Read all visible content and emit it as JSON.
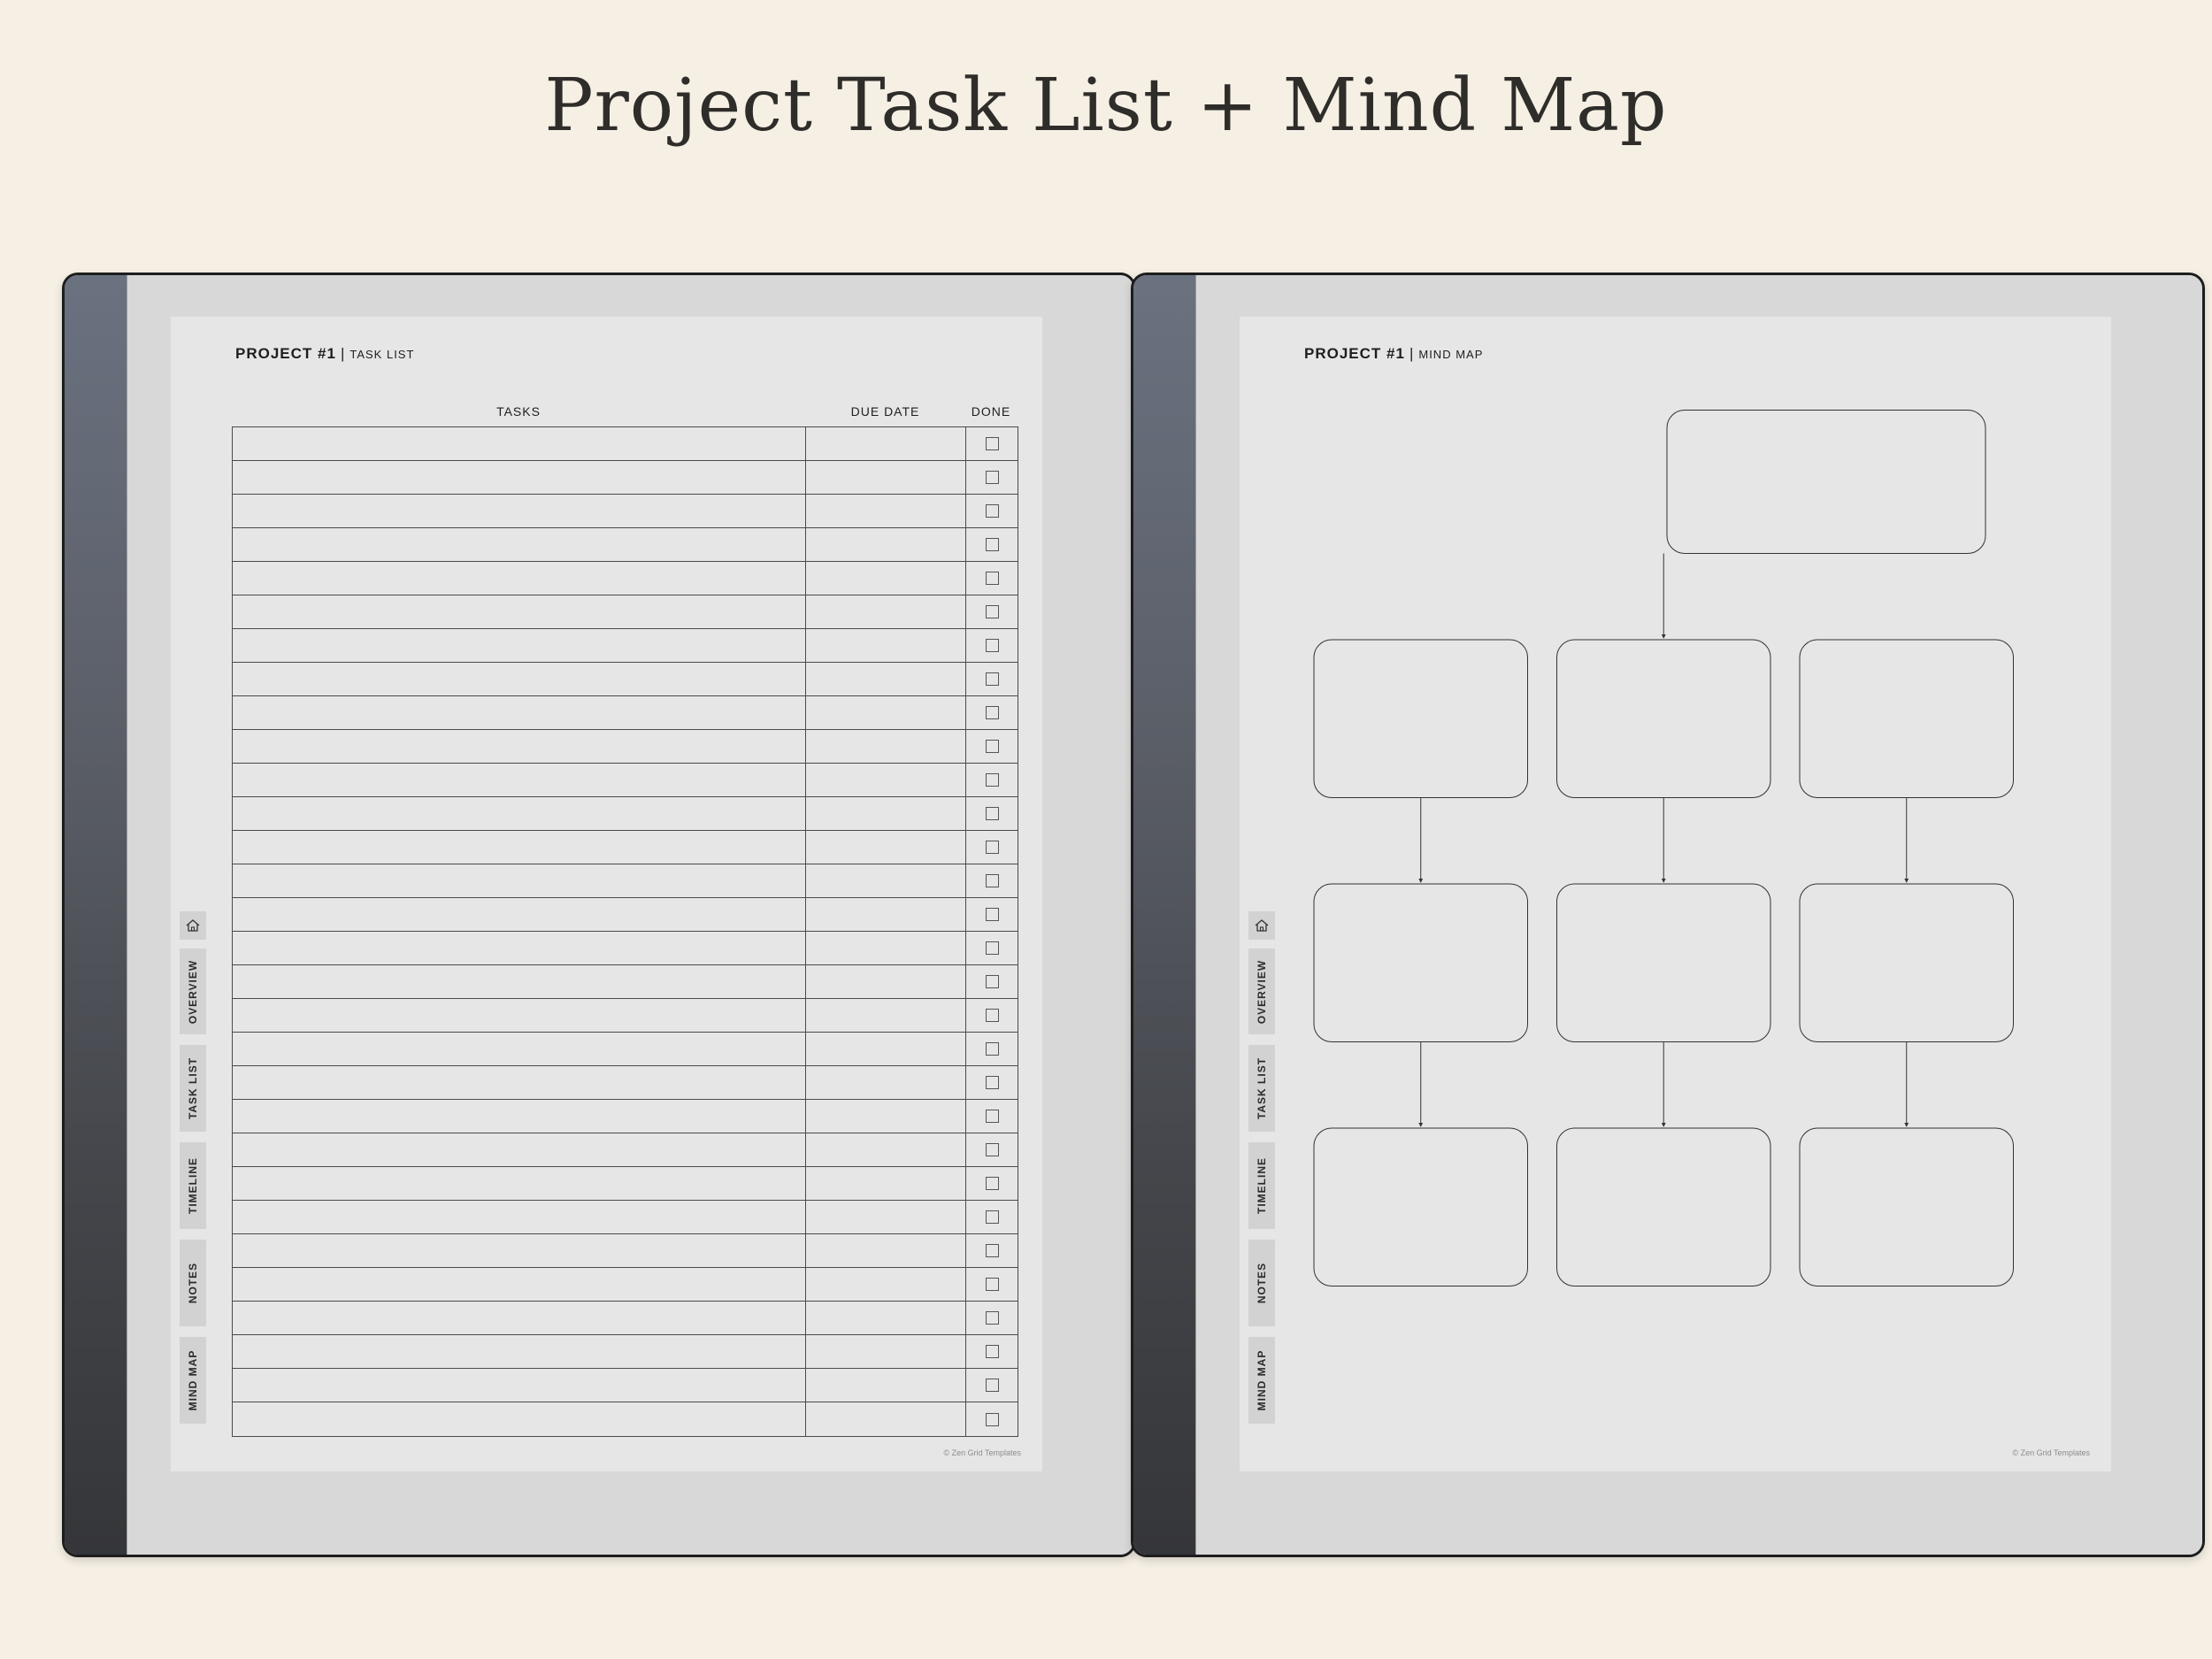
{
  "page": {
    "title": "Project Task List + Mind Map"
  },
  "task_list": {
    "header": {
      "project": "PROJECT #1",
      "separator": "|",
      "section": "TASK LIST"
    },
    "columns": {
      "tasks": "TASKS",
      "due_date": "DUE DATE",
      "done": "DONE"
    },
    "rows": [
      {
        "task": "",
        "due": "",
        "done": false
      },
      {
        "task": "",
        "due": "",
        "done": false
      },
      {
        "task": "",
        "due": "",
        "done": false
      },
      {
        "task": "",
        "due": "",
        "done": false
      },
      {
        "task": "",
        "due": "",
        "done": false
      },
      {
        "task": "",
        "due": "",
        "done": false
      },
      {
        "task": "",
        "due": "",
        "done": false
      },
      {
        "task": "",
        "due": "",
        "done": false
      },
      {
        "task": "",
        "due": "",
        "done": false
      },
      {
        "task": "",
        "due": "",
        "done": false
      },
      {
        "task": "",
        "due": "",
        "done": false
      },
      {
        "task": "",
        "due": "",
        "done": false
      },
      {
        "task": "",
        "due": "",
        "done": false
      },
      {
        "task": "",
        "due": "",
        "done": false
      },
      {
        "task": "",
        "due": "",
        "done": false
      },
      {
        "task": "",
        "due": "",
        "done": false
      },
      {
        "task": "",
        "due": "",
        "done": false
      },
      {
        "task": "",
        "due": "",
        "done": false
      },
      {
        "task": "",
        "due": "",
        "done": false
      },
      {
        "task": "",
        "due": "",
        "done": false
      },
      {
        "task": "",
        "due": "",
        "done": false
      },
      {
        "task": "",
        "due": "",
        "done": false
      },
      {
        "task": "",
        "due": "",
        "done": false
      },
      {
        "task": "",
        "due": "",
        "done": false
      },
      {
        "task": "",
        "due": "",
        "done": false
      },
      {
        "task": "",
        "due": "",
        "done": false
      },
      {
        "task": "",
        "due": "",
        "done": false
      },
      {
        "task": "",
        "due": "",
        "done": false
      },
      {
        "task": "",
        "due": "",
        "done": false
      },
      {
        "task": "",
        "due": "",
        "done": false
      }
    ],
    "footer": "© Zen Grid Templates"
  },
  "mind_map": {
    "header": {
      "project": "PROJECT #1",
      "separator": "|",
      "section": "MIND MAP"
    },
    "nodes": [
      {
        "id": "root",
        "text": ""
      },
      {
        "id": "b1",
        "text": ""
      },
      {
        "id": "b2",
        "text": ""
      },
      {
        "id": "b3",
        "text": ""
      },
      {
        "id": "c1",
        "text": ""
      },
      {
        "id": "c2",
        "text": ""
      },
      {
        "id": "c3",
        "text": ""
      },
      {
        "id": "d1",
        "text": ""
      },
      {
        "id": "d2",
        "text": ""
      },
      {
        "id": "d3",
        "text": ""
      }
    ],
    "edges": [
      [
        "root",
        "b2"
      ],
      [
        "b1",
        "c1"
      ],
      [
        "b2",
        "c2"
      ],
      [
        "b3",
        "c3"
      ],
      [
        "c1",
        "d1"
      ],
      [
        "c2",
        "d2"
      ],
      [
        "c3",
        "d3"
      ]
    ],
    "footer": "© Zen Grid Templates"
  },
  "side_tabs": {
    "home_icon": "home-icon",
    "items": [
      "OVERVIEW",
      "TASK LIST",
      "TIMELINE",
      "NOTES",
      "MIND MAP"
    ]
  }
}
